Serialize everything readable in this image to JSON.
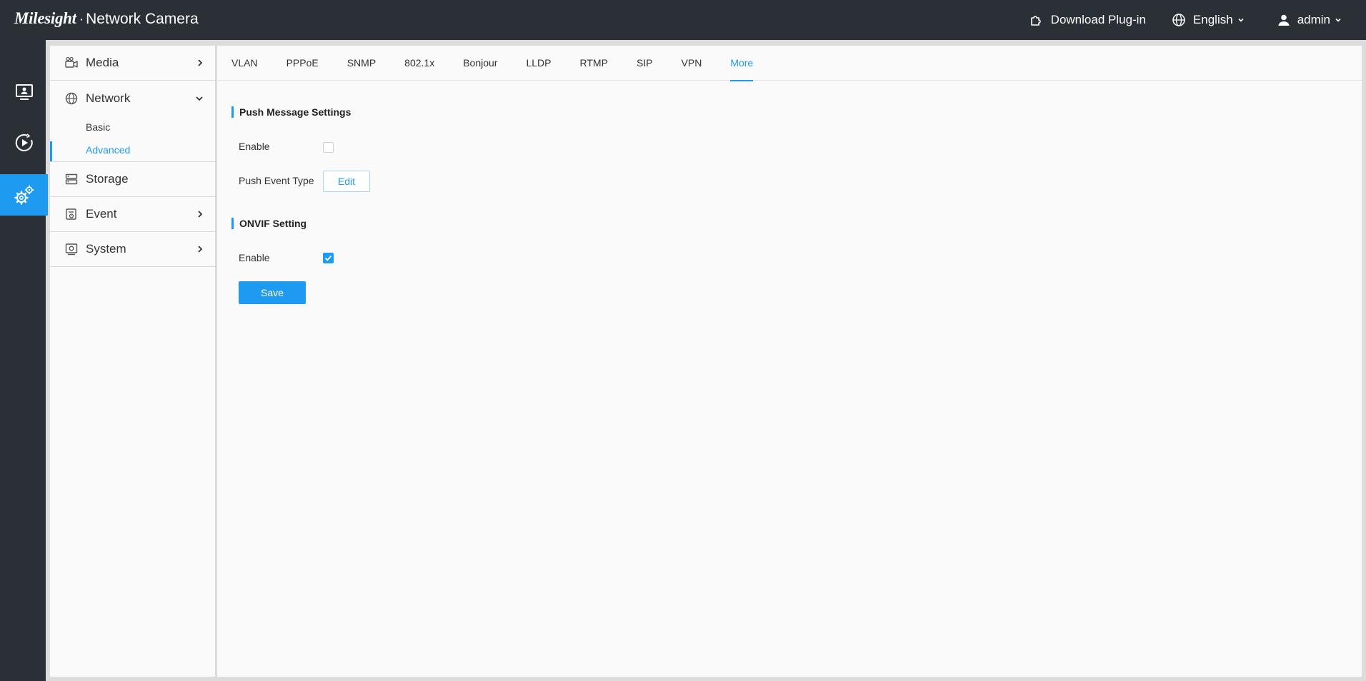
{
  "header": {
    "brand": "Milesight",
    "dot": "·",
    "title": "Network Camera",
    "download_label": "Download Plug-in",
    "language_label": "English",
    "user_label": "admin"
  },
  "rail": {
    "items": [
      {
        "name": "live-view",
        "icon": "monitor-icon"
      },
      {
        "name": "playback",
        "icon": "play-circle-icon"
      },
      {
        "name": "settings",
        "icon": "gear-icon"
      }
    ],
    "active": "settings"
  },
  "sidebar": {
    "media": "Media",
    "network": "Network",
    "network_sub": [
      "Basic",
      "Advanced"
    ],
    "active_sub": "Advanced",
    "storage": "Storage",
    "event": "Event",
    "system": "System"
  },
  "tabs": [
    "VLAN",
    "PPPoE",
    "SNMP",
    "802.1x",
    "Bonjour",
    "LLDP",
    "RTMP",
    "SIP",
    "VPN",
    "More"
  ],
  "active_tab": "More",
  "push": {
    "title": "Push Message Settings",
    "enable_label": "Enable",
    "enable_checked": false,
    "event_type_label": "Push Event Type",
    "edit_label": "Edit"
  },
  "onvif": {
    "title": "ONVIF Setting",
    "enable_label": "Enable",
    "enable_checked": true
  },
  "save_label": "Save",
  "colors": {
    "accent": "#1e9bf0",
    "topbar": "#2b2f36",
    "panel": "#fafafa"
  }
}
